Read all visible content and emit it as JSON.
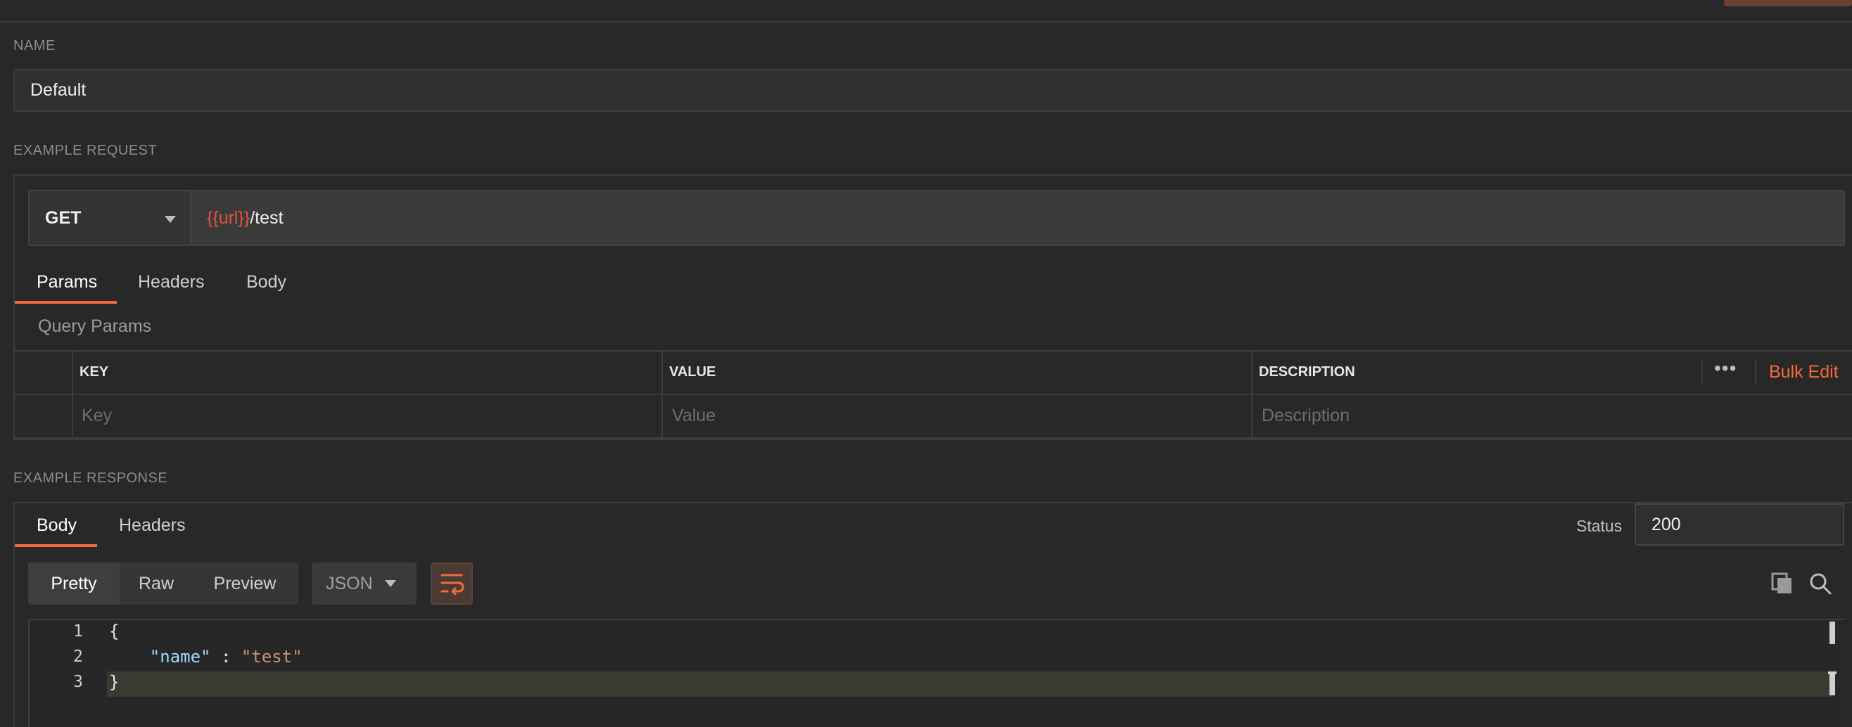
{
  "example": {
    "name_label": "NAME",
    "name_value": "Default",
    "request_label": "EXAMPLE REQUEST",
    "method": "GET",
    "url_var": "{{url}}",
    "url_path": "/test",
    "request_tabs": [
      "Params",
      "Headers",
      "Body"
    ],
    "active_request_tab": "Params",
    "query_params_label": "Query Params",
    "table": {
      "headers": [
        "KEY",
        "VALUE",
        "DESCRIPTION"
      ],
      "placeholders": [
        "Key",
        "Value",
        "Description"
      ],
      "more_icon": "ellipsis-icon",
      "bulk_edit": "Bulk Edit"
    },
    "response_label": "EXAMPLE RESPONSE",
    "response_tabs": [
      "Body",
      "Headers"
    ],
    "active_response_tab": "Body",
    "status_label": "Status",
    "status_value": "200",
    "view_modes": [
      "Pretty",
      "Raw",
      "Preview"
    ],
    "active_view_mode": "Pretty",
    "format": "JSON",
    "code_lines": [
      {
        "num": "1",
        "text": "{"
      },
      {
        "num": "2",
        "key": "\"name\"",
        "sep": " : ",
        "val": "\"test\""
      },
      {
        "num": "3",
        "text": "}"
      }
    ]
  },
  "colors": {
    "background": "#282828",
    "accent": "#f26b3a",
    "variable": "#e8523c",
    "json_key": "#9cdcfe",
    "json_string": "#ce9178"
  },
  "icons": [
    "caret-down-icon",
    "wrap-lines-icon",
    "copy-icon",
    "search-icon",
    "ellipsis-icon"
  ]
}
